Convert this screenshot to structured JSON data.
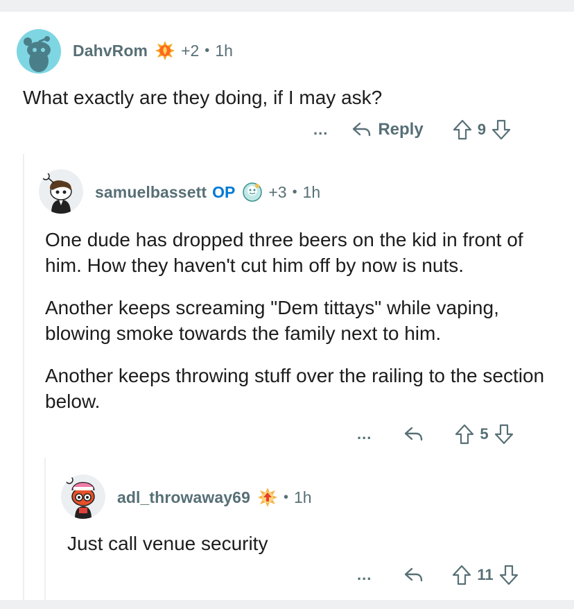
{
  "comments": [
    {
      "username": "DahvRom",
      "op_label": "",
      "flair_icon": "achievement-flame-icon",
      "karma": "+2",
      "time": "1h",
      "paragraphs": [
        "What exactly are they doing, if I may ask?"
      ],
      "more_label": "...",
      "reply_label": "Reply",
      "votes": "9"
    },
    {
      "username": "samuelbassett",
      "op_label": "OP",
      "flair_icon": "achievement-face-icon",
      "karma": "+3",
      "time": "1h",
      "paragraphs": [
        "One dude has dropped three beers on the kid in front of him.  How they haven't cut him off by now is nuts.",
        "Another keeps screaming \"Dem tittays\" while vaping, blowing smoke towards the family next to him.",
        "Another keeps throwing stuff over the railing to the section below."
      ],
      "more_label": "...",
      "reply_label": "",
      "votes": "5"
    },
    {
      "username": "adl_throwaway69",
      "op_label": "",
      "flair_icon": "achievement-arrow-icon",
      "karma": "",
      "time": "1h",
      "paragraphs": [
        "Just call venue security"
      ],
      "more_label": "...",
      "reply_label": "",
      "votes": "11"
    }
  ],
  "separator": "•",
  "colors": {
    "meta_gray": "#576f76",
    "op_blue": "#0079d3",
    "thread_line": "#edeff1",
    "band": "#eef0f2"
  }
}
